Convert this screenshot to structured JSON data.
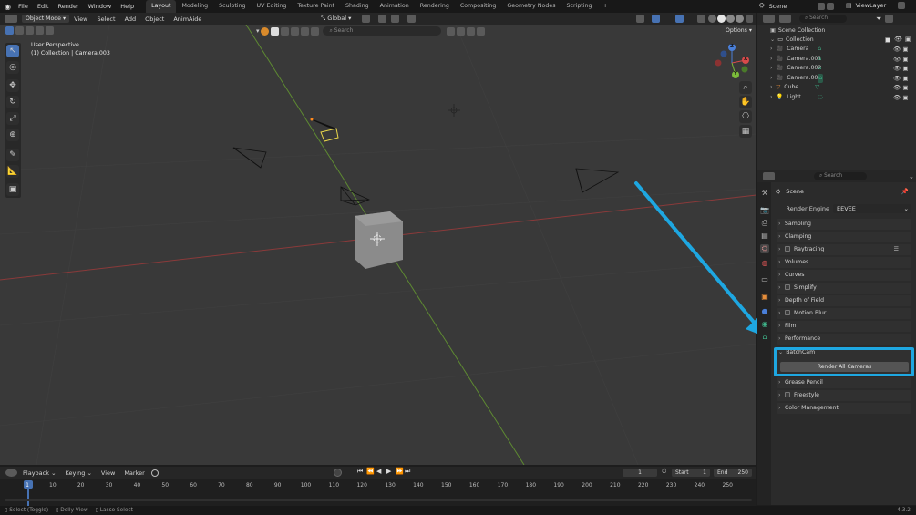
{
  "topbar": {
    "menus": [
      "File",
      "Edit",
      "Render",
      "Window",
      "Help"
    ],
    "workspaces": [
      "Layout",
      "Modeling",
      "Sculpting",
      "UV Editing",
      "Texture Paint",
      "Shading",
      "Animation",
      "Rendering",
      "Compositing",
      "Geometry Nodes",
      "Scripting"
    ],
    "plus": "+",
    "scene": "Scene",
    "view_layer": "ViewLayer"
  },
  "viewport": {
    "mode": "Object Mode",
    "menus": [
      "View",
      "Select",
      "Add",
      "Object",
      "AnimAide"
    ],
    "transform": "Global",
    "search_placeholder": "Search",
    "options": "Options",
    "perspective": "User Perspective",
    "collection_info": "(1) Collection | Camera.003",
    "gizmo_labels": [
      "Z",
      "Y",
      "X"
    ]
  },
  "outliner": {
    "search_placeholder": "Search",
    "scene_collection": "Scene Collection",
    "collection": "Collection",
    "items": [
      {
        "name": "Camera",
        "icon": "camera-icon"
      },
      {
        "name": "Camera.001",
        "icon": "camera-icon"
      },
      {
        "name": "Camera.002",
        "icon": "camera-icon"
      },
      {
        "name": "Camera.003",
        "icon": "camera-icon"
      },
      {
        "name": "Cube",
        "icon": "mesh-icon"
      },
      {
        "name": "Light",
        "icon": "light-icon"
      }
    ]
  },
  "properties": {
    "search_placeholder": "Search",
    "context": "Scene",
    "render_engine_label": "Render Engine",
    "render_engine_value": "EEVEE",
    "sections": [
      {
        "label": "Sampling",
        "checkbox": false
      },
      {
        "label": "Clamping",
        "checkbox": false
      },
      {
        "label": "Raytracing",
        "checkbox": true
      },
      {
        "label": "Volumes",
        "checkbox": false
      },
      {
        "label": "Curves",
        "checkbox": false
      },
      {
        "label": "Simplify",
        "checkbox": true
      },
      {
        "label": "Depth of Field",
        "checkbox": false
      },
      {
        "label": "Motion Blur",
        "checkbox": true
      },
      {
        "label": "Film",
        "checkbox": false
      },
      {
        "label": "Performance",
        "checkbox": false
      }
    ],
    "batchcam_label": "BatchCam",
    "render_all_button": "Render All Cameras",
    "sections_after": [
      {
        "label": "Grease Pencil",
        "checkbox": false
      },
      {
        "label": "Freestyle",
        "checkbox": true
      },
      {
        "label": "Color Management",
        "checkbox": false
      }
    ]
  },
  "timeline": {
    "menus": [
      "Playback",
      "Keying",
      "View",
      "Marker"
    ],
    "current_frame": "1",
    "start_label": "Start",
    "start_value": "1",
    "end_label": "End",
    "end_value": "250",
    "ticks": [
      "1",
      "10",
      "20",
      "30",
      "40",
      "50",
      "60",
      "70",
      "80",
      "90",
      "100",
      "110",
      "120",
      "130",
      "140",
      "150",
      "160",
      "170",
      "180",
      "190",
      "200",
      "210",
      "220",
      "230",
      "240",
      "250"
    ]
  },
  "statusbar": {
    "hints": [
      "Select (Toggle)",
      "Dolly View",
      "Lasso Select"
    ],
    "version": "4.3.2"
  },
  "colors": {
    "highlight": "#1ea7e1",
    "accent": "#4772b3",
    "camera_green": "#3fb58a"
  }
}
